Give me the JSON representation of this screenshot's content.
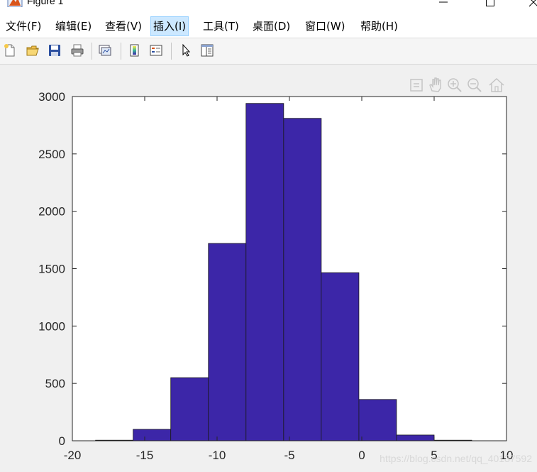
{
  "window": {
    "title": "Figure 1",
    "app_icon": "matlab-figure-icon",
    "controls": [
      "minimize-icon",
      "maximize-icon",
      "close-icon"
    ]
  },
  "menu": {
    "items": [
      "文件(F)",
      "编辑(E)",
      "查看(V)",
      "插入(I)",
      "工具(T)",
      "桌面(D)",
      "窗口(W)",
      "帮助(H)"
    ],
    "active_index": 3
  },
  "toolbar": {
    "buttons": [
      "new-figure-icon",
      "open-file-icon",
      "save-icon",
      "print-icon",
      "link-plot-icon",
      "colorbar-icon",
      "legend-icon",
      "edit-plot-arrow-icon",
      "property-inspector-icon"
    ]
  },
  "axes_toolbar": [
    "export-icon",
    "pan-hand-icon",
    "zoom-in-icon",
    "zoom-out-icon",
    "home-icon"
  ],
  "colors": {
    "bar_fill": "#3c26a8",
    "bar_edge": "#1a1a1a",
    "axes_bg": "#ffffff",
    "figure_bg": "#f0f0f0"
  },
  "chart_data": {
    "type": "bar",
    "title": "",
    "xlabel": "",
    "ylabel": "",
    "bin_edges": [
      -18.4,
      -15.8,
      -13.2,
      -10.6,
      -8.0,
      -5.4,
      -2.8,
      -0.2,
      2.4,
      5.0,
      7.6
    ],
    "values": [
      5,
      100,
      550,
      1720,
      2940,
      2810,
      1465,
      360,
      50,
      5
    ],
    "xlim": [
      -20,
      10
    ],
    "ylim": [
      0,
      3000
    ],
    "xticks": [
      "-20",
      "-15",
      "-10",
      "-5",
      "0",
      "5",
      "10"
    ],
    "yticks": [
      "0",
      "500",
      "1000",
      "1500",
      "2000",
      "2500",
      "3000"
    ],
    "grid": false
  },
  "watermark": "https://blog.csdn.net/qq_40137592"
}
